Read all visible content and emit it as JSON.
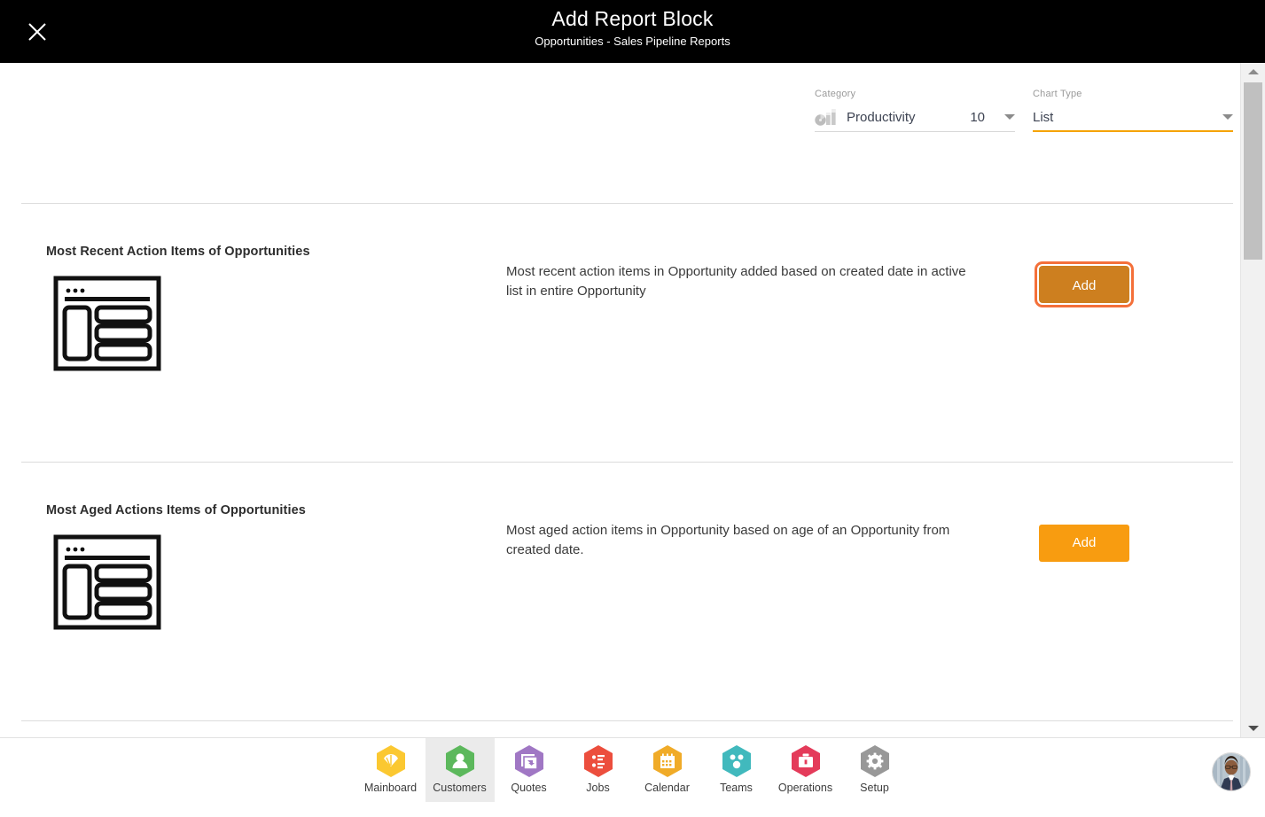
{
  "header": {
    "title": "Add Report Block",
    "subtitle": "Opportunities - Sales Pipeline Reports",
    "close_icon": "close-icon"
  },
  "controls": {
    "category": {
      "label": "Category",
      "value": "Productivity",
      "count": "10",
      "icon": "productivity-chart-icon",
      "focused": false
    },
    "chart_type": {
      "label": "Chart Type",
      "value": "List",
      "focused": true,
      "underline_color": "#f5a302"
    }
  },
  "blocks": [
    {
      "title": "Most Recent Action Items of Opportunities",
      "description": "Most recent action items in Opportunity added based on created date in active list in entire Opportunity",
      "thumbnail_icon": "list-layout-icon",
      "add_label": "Add",
      "add_focused": true
    },
    {
      "title": "Most Aged Actions Items of Opportunities",
      "description": "Most aged action items in Opportunity based on age of an Opportunity from created date.",
      "thumbnail_icon": "list-layout-icon",
      "add_label": "Add",
      "add_focused": false
    }
  ],
  "scrollbar": {
    "up_icon": "scroll-up-arrow-icon",
    "down_icon": "scroll-down-arrow-icon"
  },
  "bottom_nav": {
    "active": "Customers",
    "items": [
      {
        "label": "Mainboard",
        "icon": "mainboard-icon",
        "color": "#fbc831",
        "active": false
      },
      {
        "label": "Customers",
        "icon": "customers-icon",
        "color": "#5cb85c",
        "active": true
      },
      {
        "label": "Quotes",
        "icon": "quotes-icon",
        "color": "#a077c4",
        "active": false
      },
      {
        "label": "Jobs",
        "icon": "jobs-icon",
        "color": "#ec4e3d",
        "active": false
      },
      {
        "label": "Calendar",
        "icon": "calendar-icon",
        "color": "#f0ab28",
        "active": false
      },
      {
        "label": "Teams",
        "icon": "teams-icon",
        "color": "#41b9bd",
        "active": false
      },
      {
        "label": "Operations",
        "icon": "operations-icon",
        "color": "#e43b5a",
        "active": false
      },
      {
        "label": "Setup",
        "icon": "setup-icon",
        "color": "#989898",
        "active": false
      }
    ],
    "avatar": "user-avatar"
  },
  "colors": {
    "accent_orange": "#f89c10",
    "focus_ring": "#f4703a",
    "header_bg": "#000000"
  }
}
